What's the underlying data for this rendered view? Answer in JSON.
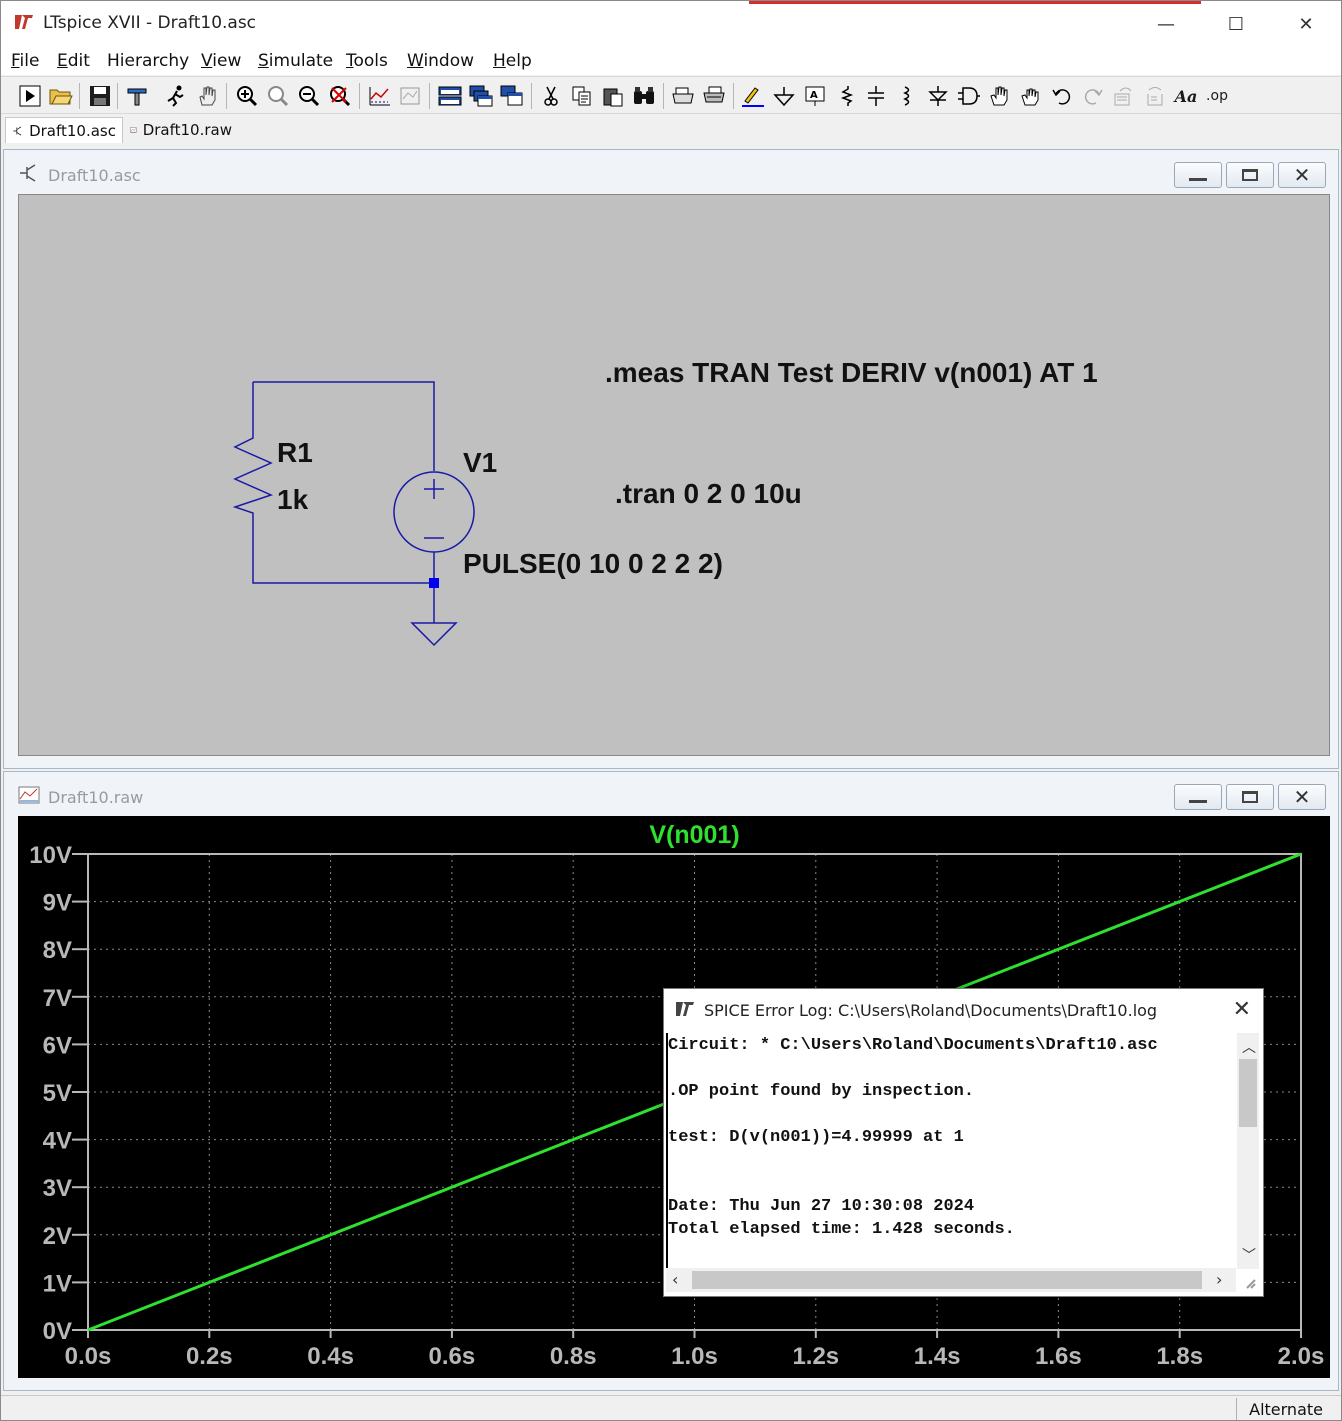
{
  "app": {
    "title": "LTspice XVII - Draft10.asc",
    "minimize_glyph": "—",
    "maximize_glyph": "☐",
    "close_glyph": "✕"
  },
  "menu": {
    "items": [
      {
        "label": "File",
        "accel": "F",
        "rest": "ile"
      },
      {
        "label": "Edit",
        "accel": "E",
        "rest": "dit"
      },
      {
        "label": "Hierarchy",
        "accel": "",
        "rest": "Hierarchy"
      },
      {
        "label": "View",
        "accel": "V",
        "rest": "iew"
      },
      {
        "label": "Simulate",
        "accel": "S",
        "rest": "imulate"
      },
      {
        "label": "Tools",
        "accel": "T",
        "rest": "ools"
      },
      {
        "label": "Window",
        "accel": "W",
        "rest": "indow"
      },
      {
        "label": "Help",
        "accel": "H",
        "rest": "elp"
      }
    ]
  },
  "toolbar": {
    "buttons": [
      "run-icon",
      "open-icon",
      "save-icon",
      "control-panel-icon",
      "run-man-icon",
      "pan-hand-icon",
      "zoom-in-icon",
      "zoom-area-icon",
      "zoom-out-icon",
      "zoom-cancel-icon",
      "autorange-icon",
      "waveform-icon",
      "tile-horizontal-icon",
      "cascade-icon",
      "tile-vertical-icon",
      "cut-icon",
      "copy-icon",
      "paste-icon",
      "find-icon",
      "print-icon",
      "print-setup-icon",
      "wire-icon",
      "ground-icon",
      "label-net-icon",
      "resistor-icon",
      "capacitor-icon",
      "inductor-icon",
      "diode-icon",
      "component-icon",
      "move-icon",
      "drag-icon",
      "undo-icon",
      "redo-icon",
      "rotate-icon",
      "mirror-icon",
      "text-icon",
      "spice-directive-icon"
    ]
  },
  "tabs": [
    {
      "label": "Draft10.asc",
      "active": true
    },
    {
      "label": "Draft10.raw",
      "active": false
    }
  ],
  "schematic_window": {
    "title": "Draft10.asc",
    "resistor_name": "R1",
    "resistor_value": "1k",
    "source_name": "V1",
    "source_value": "PULSE(0 10 0 2 2 2)",
    "meas_directive": ".meas TRAN Test DERIV v(n001) AT 1",
    "tran_directive": ".tran 0 2 0 10u",
    "wire_color": "#1a1aa6",
    "background": "#c0c0c0"
  },
  "waveform_window": {
    "title": "Draft10.raw"
  },
  "chart_data": {
    "type": "line",
    "title": "V(n001)",
    "xlabel": "",
    "ylabel": "",
    "xlim": [
      0,
      2
    ],
    "ylim": [
      0,
      10
    ],
    "x_ticks": [
      "0.0s",
      "0.2s",
      "0.4s",
      "0.6s",
      "0.8s",
      "1.0s",
      "1.2s",
      "1.4s",
      "1.6s",
      "1.8s",
      "2.0s"
    ],
    "y_ticks": [
      "0V",
      "1V",
      "2V",
      "3V",
      "4V",
      "5V",
      "6V",
      "7V",
      "8V",
      "9V",
      "10V"
    ],
    "grid": true,
    "series": [
      {
        "name": "V(n001)",
        "color": "#2fe02f",
        "x": [
          0,
          2
        ],
        "y": [
          0,
          10
        ]
      }
    ],
    "background": "#000000",
    "axis_color": "#b8b8b8"
  },
  "error_log": {
    "title": "SPICE Error Log: C:\\Users\\Roland\\Documents\\Draft10.log",
    "lines": [
      "Circuit: * C:\\Users\\Roland\\Documents\\Draft10.asc",
      ".OP point found by inspection.",
      "test: D(v(n001))=4.99999 at 1",
      "Date: Thu Jun 27 10:30:08 2024",
      "Total elapsed time: 1.428 seconds."
    ]
  },
  "statusbar": {
    "mode": "Alternate"
  }
}
